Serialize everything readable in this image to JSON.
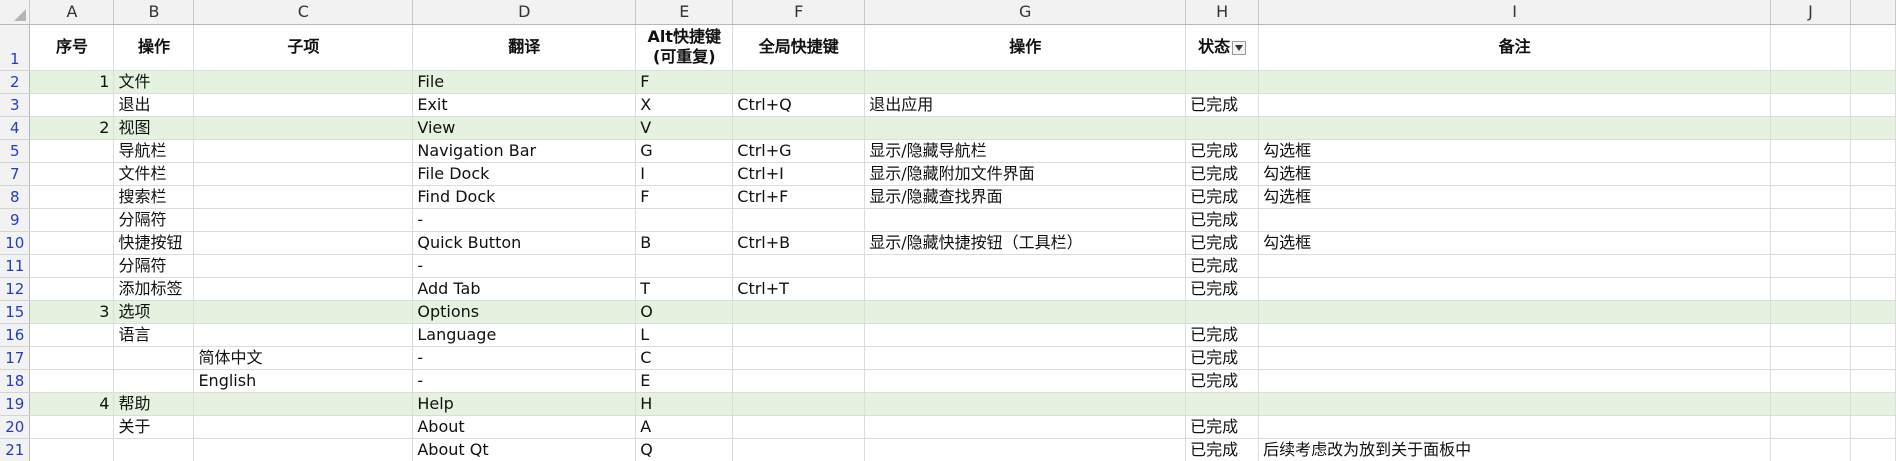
{
  "columns": [
    "A",
    "B",
    "C",
    "D",
    "E",
    "F",
    "G",
    "H",
    "I",
    "J"
  ],
  "header_row": {
    "row_number": "1",
    "cells": [
      "序号",
      "操作",
      "子项",
      "翻译",
      "Alt快捷键\n(可重复)",
      "全局快捷键",
      "操作",
      "状态",
      "备注",
      ""
    ]
  },
  "rows": [
    {
      "n": "2",
      "section": true,
      "cells": [
        "1",
        "文件",
        "",
        "File",
        "F",
        "",
        "",
        "",
        "",
        ""
      ]
    },
    {
      "n": "3",
      "section": false,
      "cells": [
        "",
        "退出",
        "",
        "Exit",
        "X",
        "Ctrl+Q",
        "退出应用",
        "已完成",
        "",
        ""
      ]
    },
    {
      "n": "4",
      "section": true,
      "cells": [
        "2",
        "视图",
        "",
        "View",
        "V",
        "",
        "",
        "",
        "",
        ""
      ]
    },
    {
      "n": "5",
      "section": false,
      "cells": [
        "",
        "导航栏",
        "",
        "Navigation Bar",
        "G",
        "Ctrl+G",
        "显示/隐藏导航栏",
        "已完成",
        "勾选框",
        ""
      ]
    },
    {
      "n": "7",
      "section": false,
      "cells": [
        "",
        "文件栏",
        "",
        "File Dock",
        "I",
        "Ctrl+I",
        "显示/隐藏附加文件界面",
        "已完成",
        "勾选框",
        ""
      ]
    },
    {
      "n": "8",
      "section": false,
      "cells": [
        "",
        "搜索栏",
        "",
        "Find Dock",
        "F",
        "Ctrl+F",
        "显示/隐藏查找界面",
        "已完成",
        "勾选框",
        ""
      ]
    },
    {
      "n": "9",
      "section": false,
      "cells": [
        "",
        "分隔符",
        "",
        "-",
        "",
        "",
        "",
        "已完成",
        "",
        ""
      ]
    },
    {
      "n": "10",
      "section": false,
      "cells": [
        "",
        "快捷按钮",
        "",
        "Quick Button",
        "B",
        "Ctrl+B",
        "显示/隐藏快捷按钮（工具栏）",
        "已完成",
        "勾选框",
        ""
      ]
    },
    {
      "n": "11",
      "section": false,
      "cells": [
        "",
        "分隔符",
        "",
        "-",
        "",
        "",
        "",
        "已完成",
        "",
        ""
      ]
    },
    {
      "n": "12",
      "section": false,
      "cells": [
        "",
        "添加标签",
        "",
        "Add Tab",
        "T",
        "Ctrl+T",
        "",
        "已完成",
        "",
        ""
      ]
    },
    {
      "n": "15",
      "section": true,
      "cells": [
        "3",
        "选项",
        "",
        "Options",
        "O",
        "",
        "",
        "",
        "",
        ""
      ]
    },
    {
      "n": "16",
      "section": false,
      "cells": [
        "",
        "语言",
        "",
        "Language",
        "L",
        "",
        "",
        "已完成",
        "",
        ""
      ]
    },
    {
      "n": "17",
      "section": false,
      "cells": [
        "",
        "",
        "简体中文",
        "-",
        "C",
        "",
        "",
        "已完成",
        "",
        ""
      ]
    },
    {
      "n": "18",
      "section": false,
      "cells": [
        "",
        "",
        "English",
        "-",
        "E",
        "",
        "",
        "已完成",
        "",
        ""
      ]
    },
    {
      "n": "19",
      "section": true,
      "cells": [
        "4",
        "帮助",
        "",
        "Help",
        "H",
        "",
        "",
        "",
        "",
        ""
      ]
    },
    {
      "n": "20",
      "section": false,
      "cells": [
        "",
        "关于",
        "",
        "About",
        "A",
        "",
        "",
        "已完成",
        "",
        ""
      ]
    },
    {
      "n": "21",
      "section": false,
      "cells": [
        "",
        "",
        "",
        "About Qt",
        "Q",
        "",
        "",
        "已完成",
        "后续考虑改为放到关于面板中",
        ""
      ]
    }
  ],
  "colors": {
    "section_fill": "#e4f2df",
    "row_number_text": "#1f3fbf",
    "header_fill": "#f2f2f2",
    "gridline": "#dcdcdc"
  },
  "icons": {
    "select_all": "corner-triangle-icon",
    "status_filter": "filter-dropdown-icon"
  }
}
